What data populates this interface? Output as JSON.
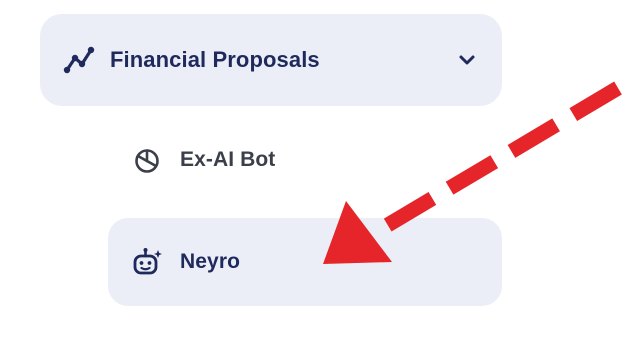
{
  "menu": {
    "parent": {
      "label": "Financial Proposals",
      "icon": "trend-line-icon",
      "expanded": true,
      "chevron": "chevron-down-icon"
    },
    "items": [
      {
        "label": "Ex-AI Bot",
        "icon": "pie-chart-icon",
        "active": false
      },
      {
        "label": "Neyro",
        "icon": "robot-icon",
        "active": true
      }
    ]
  },
  "colors": {
    "accent": "#1f2a5c",
    "item_bg": "#eceef7",
    "muted_text": "#3a3f4a",
    "annotation_arrow": "#e5252a"
  },
  "annotation": {
    "icon": "red-dashed-arrow-icon",
    "points_to": "Neyro"
  }
}
